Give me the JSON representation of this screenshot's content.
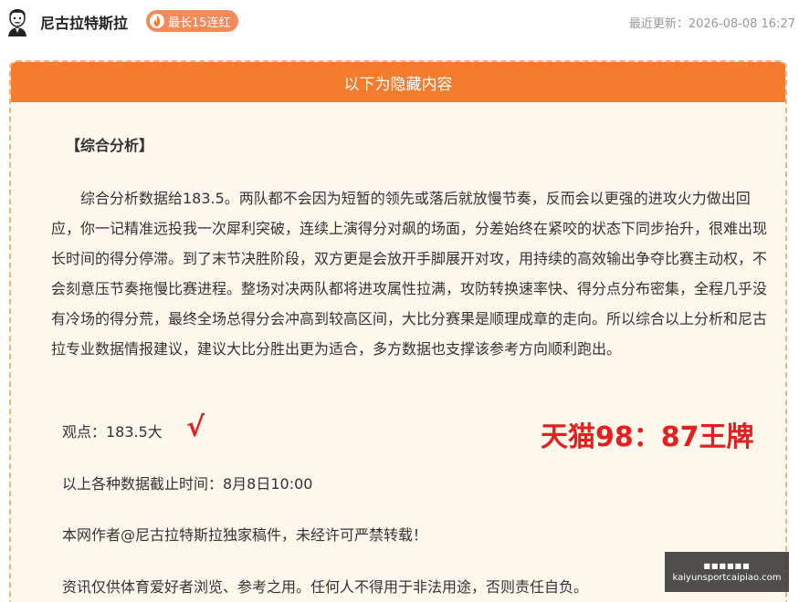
{
  "header": {
    "author": "尼古拉特斯拉",
    "streak_badge": "最长15连红",
    "updated": "最近更新：2026-08-08 16:27"
  },
  "hidden_section": {
    "banner": "以下为隐藏内容",
    "section_title": "【综合分析】",
    "analysis": "综合分析数据给183.5。两队都不会因为短暂的领先或落后就放慢节奏，反而会以更强的进攻火力做出回应，你一记精准远投我一次犀利突破，连续上演得分对飙的场面，分差始终在紧咬的状态下同步抬升，很难出现长时间的得分停滞。到了末节决胜阶段，双方更是会放开手脚展开对攻，用持续的高效输出争夺比赛主动权，不会刻意压节奏拖慢比赛进程。整场对决两队都将进攻属性拉满，攻防转换速率快、得分点分布密集，全程几乎没有冷场的得分荒，最终全场总得分会冲高到较高区间，大比分赛果是顺理成章的走向。所以综合以上分析和尼古拉专业数据情报建议，建议大比分胜出更为适合，多方数据也支撑该参考方向顺利跑出。",
    "view": "观点：183.5大",
    "check_mark": "√",
    "result": "天猫98：87王牌",
    "cutoff": "以上各种数据截止时间：8月8日10:00",
    "copyright": "本网作者@尼古拉特斯拉独家稿件，未经许可严禁转载！",
    "disclaimer": "资讯仅供体育爱好者浏览、参考之用。任何人不得用于非法用途，否则责任自负。"
  },
  "watermark": {
    "url": "kaiyunsportcaipiao.com"
  },
  "colors": {
    "accent": "#f57c2c",
    "badge": "#f58a5a",
    "result_red": "#e51f1f",
    "panel_bg": "#fff8ec"
  },
  "icons": [
    "avatar-sketch-icon",
    "flame-icon"
  ]
}
